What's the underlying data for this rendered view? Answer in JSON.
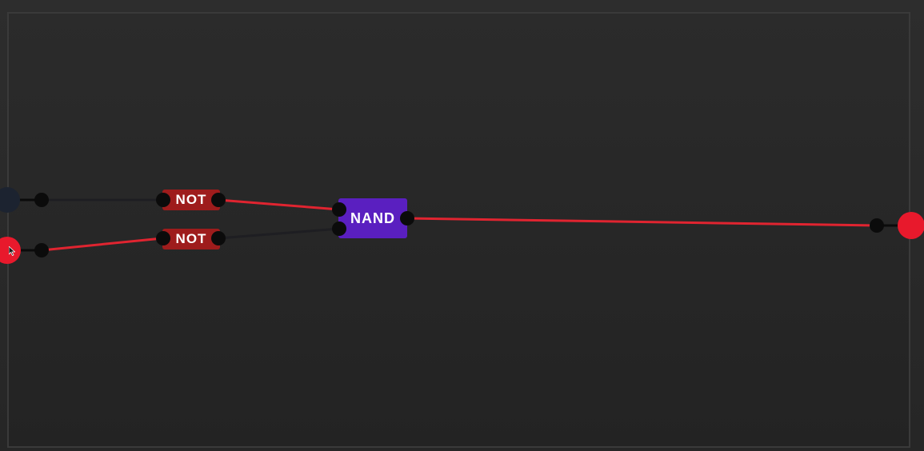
{
  "canvas": {
    "background_color": "#2a2a2a",
    "wire_on_color": "#e02430",
    "wire_off_color": "#1e1e22"
  },
  "inputs": [
    {
      "name": "input-a",
      "state": "off",
      "color": "#1c2330"
    },
    {
      "name": "input-b",
      "state": "on",
      "color": "#e8192c"
    }
  ],
  "gates": {
    "not_top": {
      "label": "NOT",
      "color": "#9e1c1c"
    },
    "not_bottom": {
      "label": "NOT",
      "color": "#9e1c1c"
    },
    "nand": {
      "label": "NAND",
      "color": "#5a1fc0"
    }
  },
  "output": {
    "state": "on",
    "color": "#e8192c"
  },
  "cursor": {
    "icon": "mouse-pointer-icon"
  }
}
